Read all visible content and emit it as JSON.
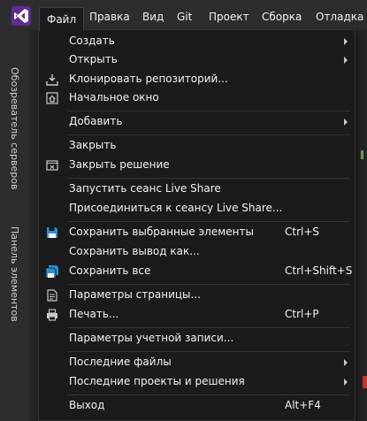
{
  "menubar": {
    "items": [
      {
        "label": "Файл"
      },
      {
        "label": "Правка"
      },
      {
        "label": "Вид"
      },
      {
        "label": "Git"
      },
      {
        "label": "Проект"
      },
      {
        "label": "Сборка"
      },
      {
        "label": "Отладка"
      }
    ]
  },
  "side_tabs": {
    "server_explorer": "Обозреватель серверов",
    "toolbox": "Панель элементов"
  },
  "file_menu": {
    "create": "Создать",
    "open": "Открыть",
    "clone": "Клонировать репозиторий...",
    "start_window": "Начальное окно",
    "add": "Добавить",
    "close": "Закрыть",
    "close_solution": "Закрыть решение",
    "live_share_start": "Запустить сеанс Live Share",
    "live_share_join": "Присоединиться к сеансу Live Share...",
    "save_selected": "Сохранить выбранные элементы",
    "save_selected_shortcut": "Ctrl+S",
    "save_output": "Сохранить вывод как...",
    "save_all": "Сохранить все",
    "save_all_shortcut": "Ctrl+Shift+S",
    "page_setup": "Параметры страницы...",
    "print": "Печать...",
    "print_shortcut": "Ctrl+P",
    "account_settings": "Параметры учетной записи...",
    "recent_files": "Последние файлы",
    "recent_projects": "Последние проекты и решения",
    "exit": "Выход",
    "exit_shortcut": "Alt+F4"
  },
  "colors": {
    "accent": "#68217a",
    "menu_bg": "#1b1b1c",
    "save_icon": "#2a8fd6"
  }
}
